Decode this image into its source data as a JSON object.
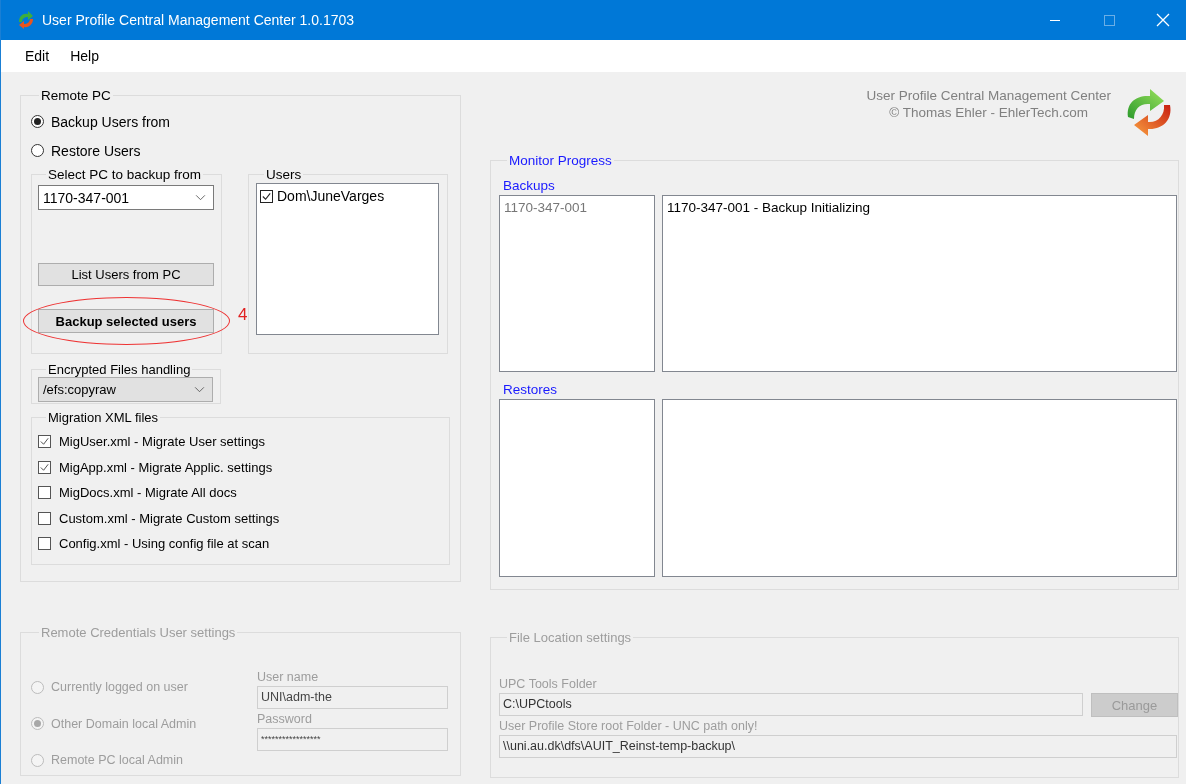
{
  "window": {
    "title": "User Profile Central Management Center 1.0.1703"
  },
  "menu": [
    {
      "label": "Edit"
    },
    {
      "label": "Help"
    }
  ],
  "remote_pc": {
    "title": "Remote PC",
    "modes": [
      {
        "label": "Backup Users from",
        "selected": true
      },
      {
        "label": "Restore Users",
        "selected": false
      }
    ],
    "select_pc": {
      "title": "Select PC to backup from",
      "value": "1170-347-001",
      "buttons": [
        {
          "label": "List Users from PC",
          "kind": "normal"
        },
        {
          "label": "Backup selected users",
          "kind": "primary"
        }
      ]
    },
    "users": {
      "title": "Users",
      "items": [
        {
          "label": "Dom\\JuneVarges",
          "checked": true
        }
      ]
    },
    "encrypted": {
      "title": "Encrypted Files handling",
      "value": "/efs:copyraw"
    },
    "migration": {
      "title": "Migration XML files",
      "items": [
        {
          "label": "MigUser.xml - Migrate User settings",
          "checked": true
        },
        {
          "label": "MigApp.xml - Migrate Applic. settings",
          "checked": true
        },
        {
          "label": "MigDocs.xml - Migrate All docs",
          "checked": false
        },
        {
          "label": "Custom.xml - Migrate Custom settings",
          "checked": false
        },
        {
          "label": "Config.xml - Using config file at scan",
          "checked": false
        }
      ]
    }
  },
  "annotation": {
    "label": "4"
  },
  "about": {
    "lines": [
      "User Profile Central Management Center",
      "© Thomas Ehler - EhlerTech.com"
    ]
  },
  "monitor": {
    "title": "Monitor Progress",
    "backups": {
      "title": "Backups",
      "hosts": [
        "1170-347-001"
      ],
      "log": [
        "1170-347-001 - Backup Initializing"
      ]
    },
    "restores": {
      "title": "Restores"
    }
  },
  "credentials": {
    "title": "Remote Credentials User settings",
    "disabled": true,
    "options": [
      {
        "label": "Currently logged on user",
        "selected": false
      },
      {
        "label": "Other Domain local Admin",
        "selected": true
      },
      {
        "label": "Remote PC local Admin",
        "selected": false
      }
    ],
    "username_label": "User name",
    "username": "UNI\\adm-the",
    "password_label": "Password",
    "password": "*****************"
  },
  "file_location": {
    "title": "File Location settings",
    "disabled": true,
    "tools_label": "UPC Tools Folder",
    "tools_folder": "C:\\UPCtools",
    "change_button": "Change",
    "store_label": "User Profile Store root Folder - UNC path only!",
    "store_folder": "\\\\uni.au.dk\\dfs\\AUIT_Reinst-temp-backup\\"
  }
}
